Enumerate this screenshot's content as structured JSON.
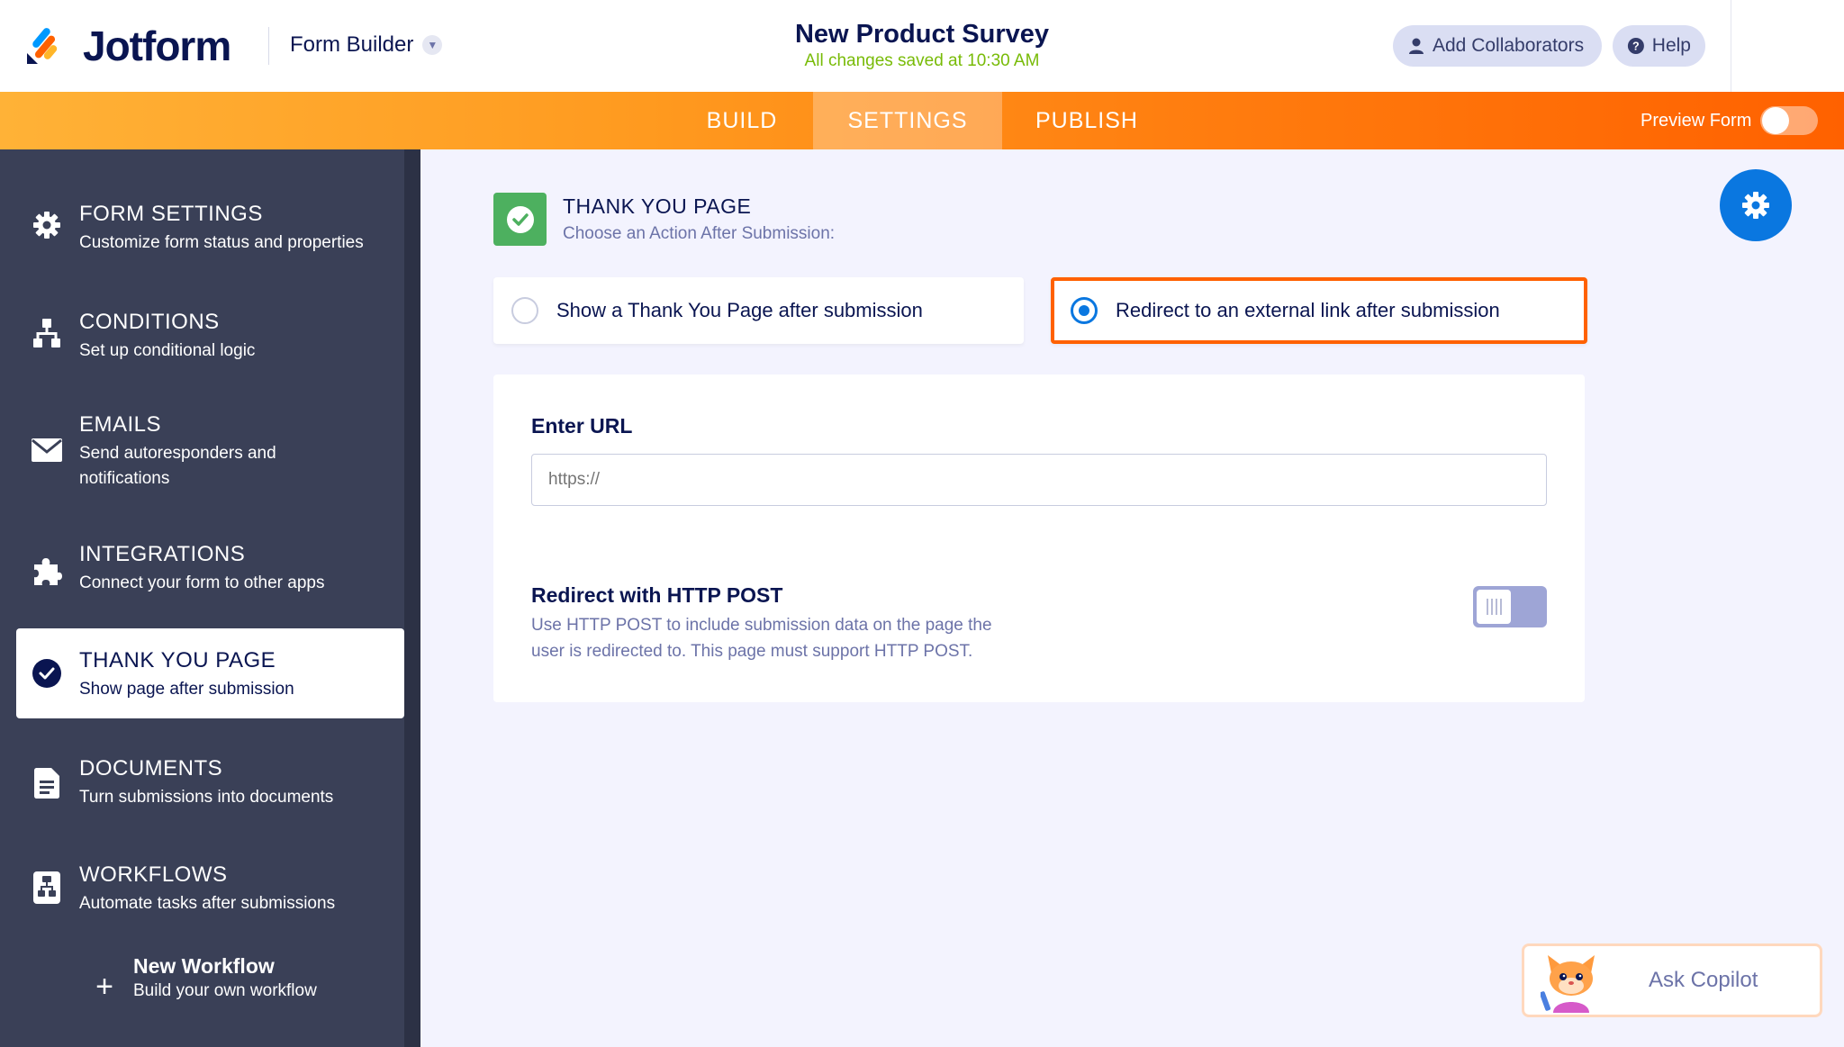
{
  "header": {
    "logo_text": "Jotform",
    "builder_label": "Form Builder",
    "form_title": "New Product Survey",
    "saved_status": "All changes saved at 10:30 AM",
    "add_collaborators": "Add Collaborators",
    "help": "Help"
  },
  "nav": {
    "tabs": [
      {
        "label": "BUILD"
      },
      {
        "label": "SETTINGS",
        "active": true
      },
      {
        "label": "PUBLISH"
      }
    ],
    "preview_label": "Preview Form",
    "preview_on": false
  },
  "sidebar": {
    "items": [
      {
        "title": "FORM SETTINGS",
        "subtitle": "Customize form status and properties",
        "icon": "gear-icon"
      },
      {
        "title": "CONDITIONS",
        "subtitle": "Set up conditional logic",
        "icon": "sitemap-icon"
      },
      {
        "title": "EMAILS",
        "subtitle": "Send autoresponders and notifications",
        "icon": "envelope-icon"
      },
      {
        "title": "INTEGRATIONS",
        "subtitle": "Connect your form to other apps",
        "icon": "puzzle-icon"
      },
      {
        "title": "THANK YOU PAGE",
        "subtitle": "Show page after submission",
        "icon": "check-circle-icon",
        "active": true
      },
      {
        "title": "DOCUMENTS",
        "subtitle": "Turn submissions into documents",
        "icon": "document-icon"
      },
      {
        "title": "WORKFLOWS",
        "subtitle": "Automate tasks after submissions",
        "icon": "workflow-icon"
      }
    ],
    "new_workflow": {
      "title": "New Workflow",
      "subtitle": "Build your own workflow",
      "icon": "plus-icon"
    }
  },
  "main": {
    "section_title": "THANK YOU PAGE",
    "section_subtitle": "Choose an Action After Submission:",
    "options": [
      {
        "label": "Show a Thank You Page after submission",
        "selected": false
      },
      {
        "label": "Redirect to an external link after submission",
        "selected": true
      }
    ],
    "url_label": "Enter URL",
    "url_placeholder": "https://",
    "url_value": "",
    "post_title": "Redirect with HTTP POST",
    "post_desc_line1": "Use HTTP POST to include submission data on the page the",
    "post_desc_line2": "user is redirected to. This page must support HTTP POST.",
    "post_enabled": false
  },
  "copilot": {
    "label": "Ask Copilot"
  },
  "colors": {
    "brand_orange": "#ff6100",
    "accent_blue": "#0a77e0",
    "success_green": "#4db05f",
    "saved_green": "#78bb07",
    "sidebar_bg": "#3a4057",
    "navy_text": "#0a1551"
  }
}
